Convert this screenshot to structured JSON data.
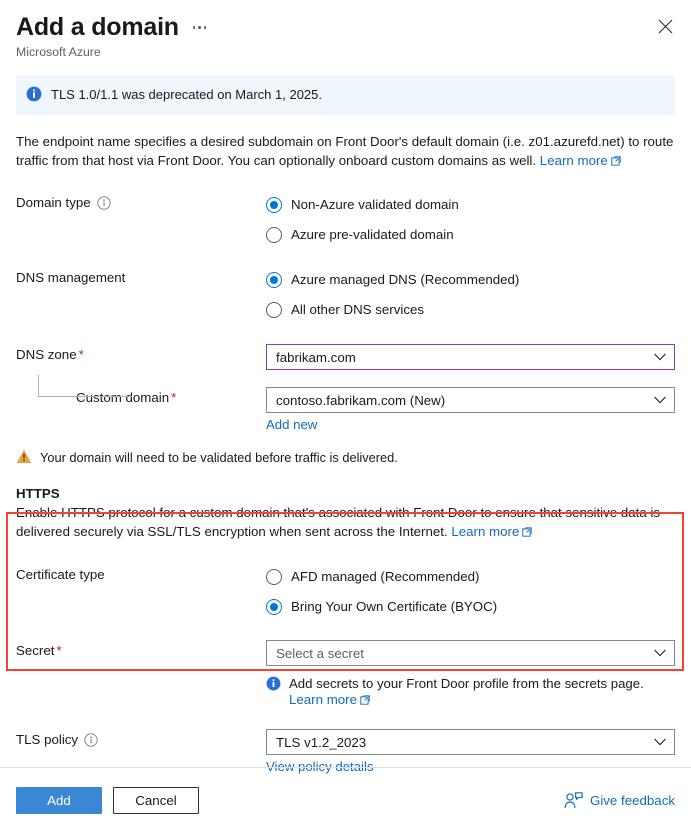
{
  "header": {
    "title": "Add a domain",
    "subtitle": "Microsoft Azure",
    "more_menu": "more-options",
    "close": "Close"
  },
  "banner": {
    "icon": "info-filled-icon",
    "message": "TLS 1.0/1.1 was deprecated on March 1, 2025."
  },
  "intro": {
    "text": "The endpoint name specifies a desired subdomain on Front Door's default domain (i.e. z01.azurefd.net) to route traffic from that host via Front Door. You can optionally onboard custom domains as well.",
    "learn_more": "Learn more"
  },
  "domain_type": {
    "label": "Domain type",
    "options": [
      {
        "label": "Non-Azure validated domain",
        "selected": true
      },
      {
        "label": "Azure pre-validated domain",
        "selected": false
      }
    ]
  },
  "dns_management": {
    "label": "DNS management",
    "options": [
      {
        "label": "Azure managed DNS (Recommended)",
        "selected": true
      },
      {
        "label": "All other DNS services",
        "selected": false
      }
    ]
  },
  "dns_zone": {
    "label": "DNS zone",
    "required": "*",
    "value": "fabrikam.com"
  },
  "custom_domain": {
    "label": "Custom domain",
    "required": "*",
    "value": "contoso.fabrikam.com (New)",
    "add_new": "Add new"
  },
  "validation_warning": {
    "icon": "warning-icon",
    "text": "Your domain will need to be validated before traffic is delivered."
  },
  "https": {
    "heading": "HTTPS",
    "description": "Enable HTTPS protocol for a custom domain that's associated with Front Door to ensure that sensitive data is delivered securely via SSL/TLS encryption when sent across the Internet.",
    "learn_more": "Learn more"
  },
  "certificate_type": {
    "label": "Certificate type",
    "options": [
      {
        "label": "AFD managed (Recommended)",
        "selected": false
      },
      {
        "label": "Bring Your Own Certificate (BYOC)",
        "selected": true
      }
    ]
  },
  "secret": {
    "label": "Secret",
    "required": "*",
    "placeholder": "Select a secret",
    "note": "Add secrets to your Front Door profile from the secrets page.",
    "learn_more": "Learn more"
  },
  "tls_policy": {
    "label": "TLS policy",
    "value": "TLS v1.2_2023",
    "details_link": "View policy details"
  },
  "footer": {
    "add_label": "Add",
    "cancel_label": "Cancel",
    "feedback_label": "Give feedback",
    "feedback_icon": "feedback-person-icon"
  },
  "colors": {
    "accent": "#0078d4",
    "link": "#0f6cbd",
    "primary_button": "#3b87d4",
    "highlight_box": "#f44336",
    "focus_border": "#8a3ea8",
    "warning": "#d98e28",
    "required": "#a4262c",
    "banner_bg": "#eff6fc"
  }
}
